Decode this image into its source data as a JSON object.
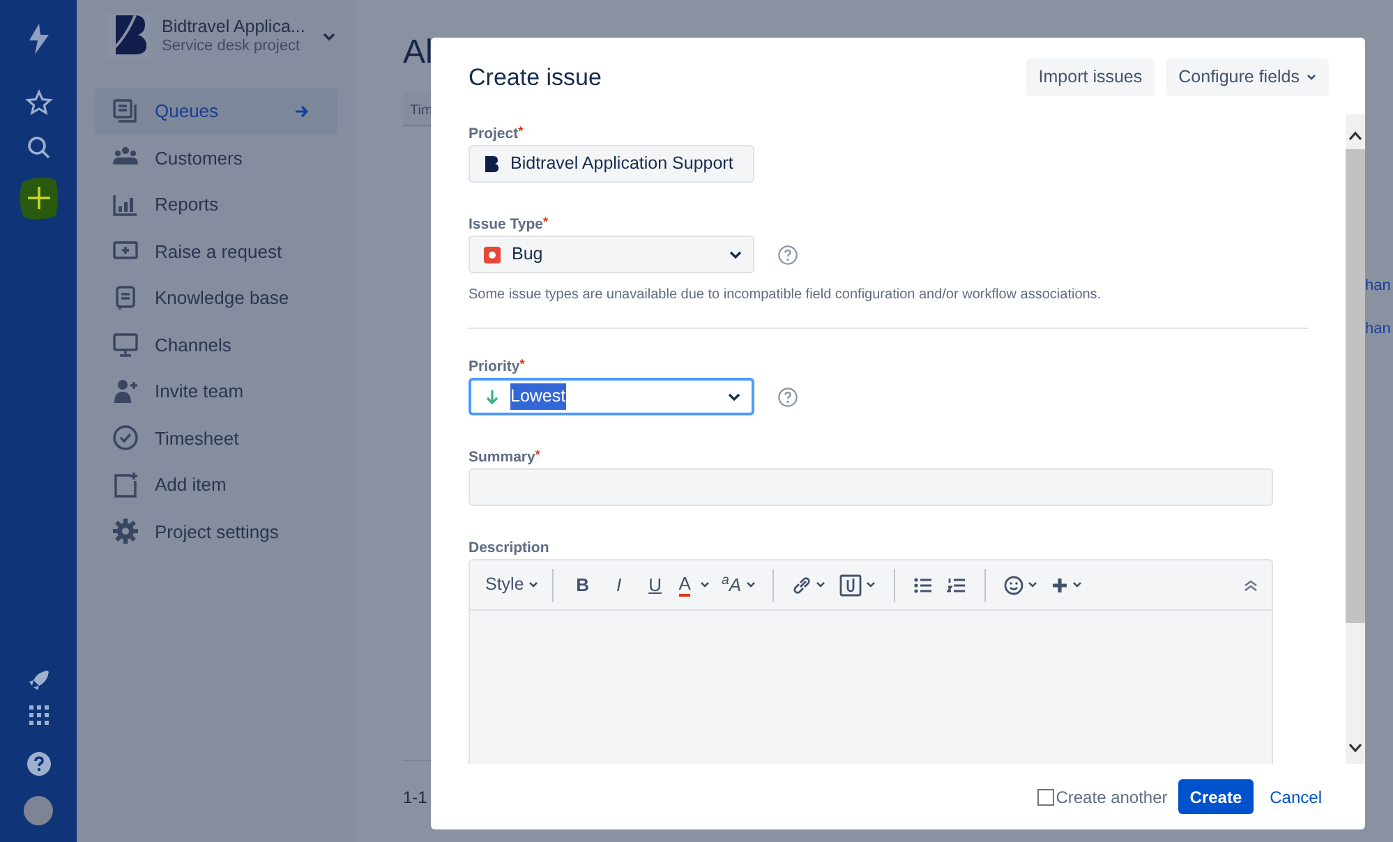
{
  "sidebar": {
    "project_name": "Bidtravel Applica...",
    "project_type": "Service desk project",
    "items": [
      {
        "label": "Queues",
        "selected": true
      },
      {
        "label": "Customers",
        "selected": false
      },
      {
        "label": "Reports",
        "selected": false
      },
      {
        "label": "Raise a request",
        "selected": false
      },
      {
        "label": "Knowledge base",
        "selected": false
      },
      {
        "label": "Channels",
        "selected": false
      },
      {
        "label": "Invite team",
        "selected": false
      },
      {
        "label": "Timesheet",
        "selected": false
      },
      {
        "label": "Add item",
        "selected": false
      },
      {
        "label": "Project settings",
        "selected": false
      }
    ]
  },
  "background_page": {
    "heading": "Al",
    "table_header": "Tim",
    "links": [
      "han",
      "han"
    ],
    "pagination": "1-1"
  },
  "dialog": {
    "title": "Create issue",
    "header_buttons": [
      {
        "label": "Import issues",
        "kind": "plain"
      },
      {
        "label": "Configure fields",
        "kind": "menu"
      }
    ],
    "fields": [
      {
        "kind": "select",
        "label": "Project",
        "required_mark": "*",
        "value": "Bidtravel Application Support",
        "help": false,
        "focused": false
      },
      {
        "kind": "select",
        "label": "Issue Type",
        "required_mark": "*",
        "value": "Bug",
        "help": true,
        "focused": false,
        "note": "Some issue types are unavailable due to incompatible field configuration and/or workflow associations."
      },
      {
        "kind": "select",
        "label": "Priority",
        "required_mark": "*",
        "value": "Lowest",
        "help": true,
        "focused": true
      },
      {
        "kind": "text",
        "label": "Summary",
        "required_mark": "*"
      },
      {
        "kind": "editor",
        "label": "Description"
      }
    ],
    "toolbar": [
      {
        "kind": "style",
        "label": "Style"
      },
      {
        "kind": "sep"
      },
      {
        "kind": "bold",
        "label": "B"
      },
      {
        "kind": "italic",
        "label": "I"
      },
      {
        "kind": "underline",
        "label": "U"
      },
      {
        "kind": "color",
        "label": "A"
      },
      {
        "kind": "size",
        "label": "$^{a}$A"
      },
      {
        "kind": "sep"
      },
      {
        "kind": "link"
      },
      {
        "kind": "attach"
      },
      {
        "kind": "sep"
      },
      {
        "kind": "bullets"
      },
      {
        "kind": "numbers"
      },
      {
        "kind": "sep"
      },
      {
        "kind": "emoji"
      },
      {
        "kind": "insert"
      }
    ],
    "create_another": {
      "label": "Create another",
      "checked": false
    },
    "submit": "Create",
    "cancel": "Cancel"
  }
}
